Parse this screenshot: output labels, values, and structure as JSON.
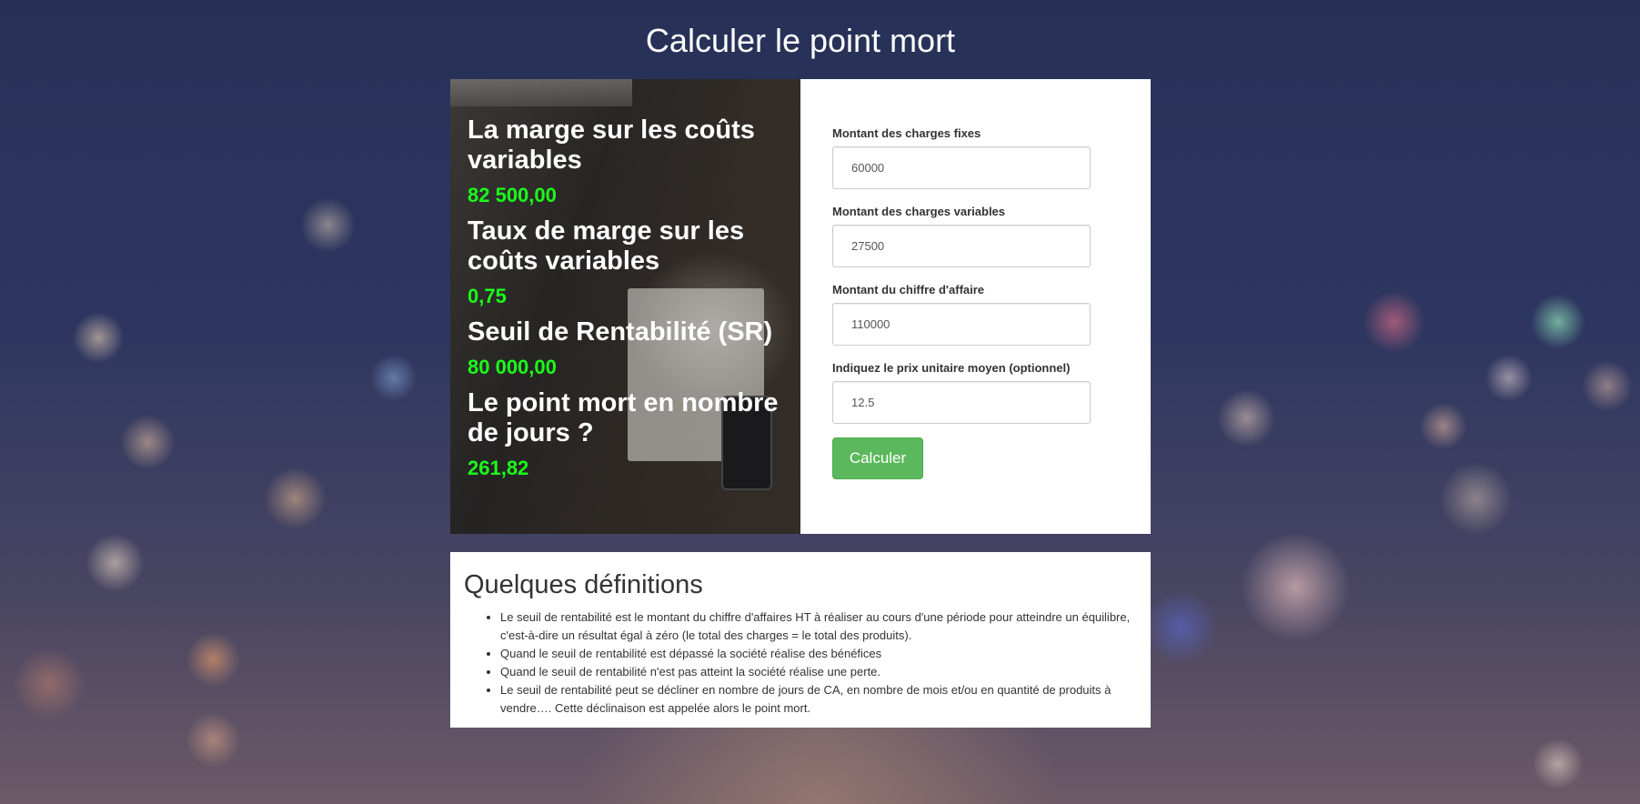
{
  "page": {
    "title": "Calculer le point mort"
  },
  "results": [
    {
      "label": "La marge sur les coûts variables",
      "value": "82 500,00"
    },
    {
      "label": "Taux de marge sur les coûts variables",
      "value": "0,75"
    },
    {
      "label": "Seuil de Rentabilité (SR)",
      "value": "80 000,00"
    },
    {
      "label": "Le point mort en nombre de jours ?",
      "value": "261,82"
    }
  ],
  "form": {
    "fixed_costs": {
      "label": "Montant des charges fixes",
      "value": "60000"
    },
    "variable_costs": {
      "label": "Montant des charges variables",
      "value": "27500"
    },
    "revenue": {
      "label": "Montant du chiffre d'affaire",
      "value": "110000"
    },
    "unit_price": {
      "label": "Indiquez le prix unitaire moyen (optionnel)",
      "value": "12.5"
    },
    "submit_label": "Calculer"
  },
  "definitions": {
    "title": "Quelques définitions",
    "items": [
      "Le seuil de rentabilité est le montant du chiffre d'affaires HT à réaliser au cours d'une période pour atteindre un équilibre, c'est-à-dire un résultat égal à zéro (le total des charges = le total des produits).",
      "Quand le seuil de rentabilité est dépassé la société réalise des bénéfices",
      "Quand le seuil de rentabilité n'est pas atteint la société réalise une perte.",
      "Le seuil de rentabilité peut se décliner en nombre de jours de CA, en nombre de mois et/ou en quantité de produits à vendre…. Cette déclinaison est appelée alors le point mort."
    ]
  },
  "colors": {
    "result_value": "#1aff1a",
    "button": "#5cb85c"
  }
}
